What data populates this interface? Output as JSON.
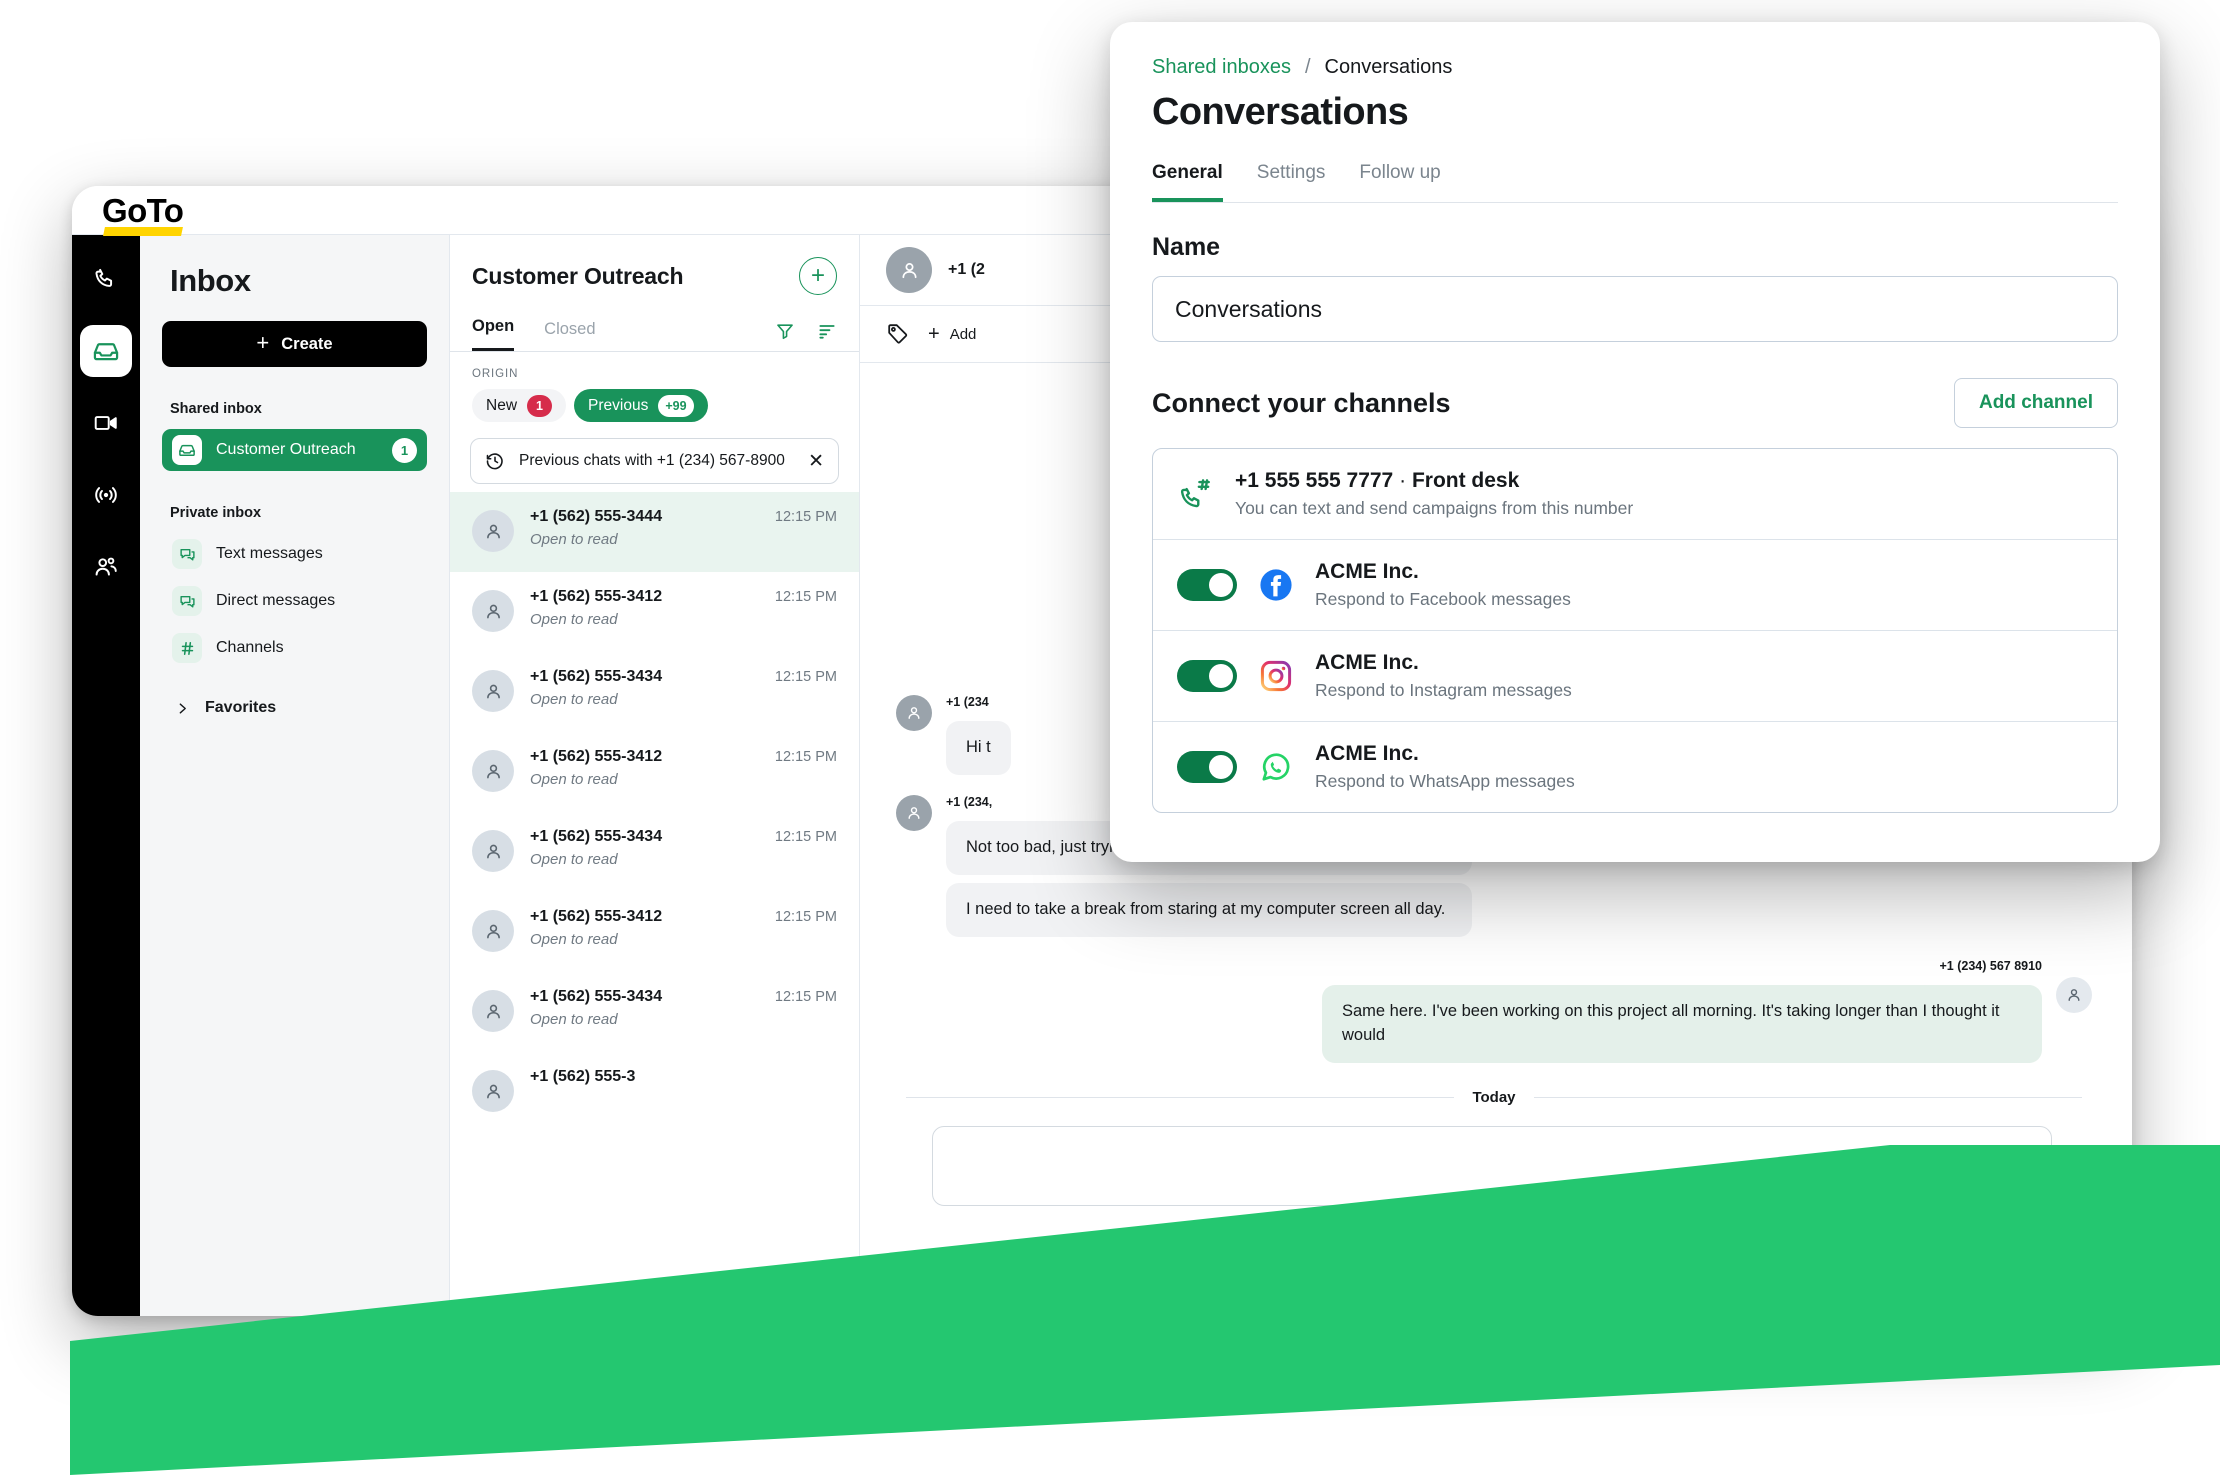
{
  "brand": {
    "name": "GoTo"
  },
  "rail": {
    "items": [
      {
        "name": "phone-icon",
        "label": "Calls"
      },
      {
        "name": "inbox-icon",
        "label": "Inbox",
        "active": true
      },
      {
        "name": "meetings-icon",
        "label": "Meetings"
      },
      {
        "name": "broadcast-icon",
        "label": "Campaigns"
      },
      {
        "name": "contacts-icon",
        "label": "Contacts"
      }
    ]
  },
  "nav": {
    "title": "Inbox",
    "create_label": "Create",
    "shared_section": "Shared inbox",
    "shared_items": [
      {
        "label": "Customer Outreach",
        "badge": "1",
        "selected": true
      }
    ],
    "private_section": "Private inbox",
    "private_items": [
      {
        "label": "Text messages",
        "icon": "chat-icon"
      },
      {
        "label": "Direct messages",
        "icon": "chat-icon"
      },
      {
        "label": "Channels",
        "icon": "hash-icon"
      }
    ],
    "favorites_label": "Favorites"
  },
  "list": {
    "title": "Customer Outreach",
    "tabs": [
      {
        "label": "Open",
        "active": true
      },
      {
        "label": "Closed",
        "active": false
      }
    ],
    "origin_label": "ORIGIN",
    "chips": [
      {
        "label": "New",
        "count": "1",
        "style": "light"
      },
      {
        "label": "Previous",
        "count": "+99",
        "style": "green"
      }
    ],
    "search_filter": "Previous chats with +1 (234) 567-8900",
    "conversations": [
      {
        "number": "+1 (562) 555-3444",
        "time": "12:15 PM",
        "preview": "Open to read",
        "selected": true
      },
      {
        "number": "+1 (562) 555-3412",
        "time": "12:15 PM",
        "preview": "Open to read",
        "selected": false
      },
      {
        "number": "+1 (562) 555-3434",
        "time": "12:15 PM",
        "preview": "Open to read",
        "selected": false
      },
      {
        "number": "+1 (562) 555-3412",
        "time": "12:15 PM",
        "preview": "Open to read",
        "selected": false
      },
      {
        "number": "+1 (562) 555-3434",
        "time": "12:15 PM",
        "preview": "Open to read",
        "selected": false
      },
      {
        "number": "+1 (562) 555-3412",
        "time": "12:15 PM",
        "preview": "Open to read",
        "selected": false
      },
      {
        "number": "+1 (562) 555-3434",
        "time": "12:15 PM",
        "preview": "Open to read",
        "selected": false
      },
      {
        "number": "+1 (562) 555-3",
        "time": "",
        "preview": "",
        "selected": false
      }
    ]
  },
  "chat": {
    "header_number": "+1 (2",
    "add_tag_label": "Add",
    "messages": [
      {
        "dir": "in",
        "meta": "+1 (234",
        "text": "Hi t"
      },
      {
        "dir": "in",
        "meta": "+1 (234,",
        "text": "Not too bad, just trying to catch up on some work. How about you?"
      },
      {
        "dir": "in",
        "meta": "",
        "text": "I need to take a break from staring at my computer screen all day."
      },
      {
        "dir": "out",
        "meta": "+1 (234) 567 8910",
        "text": "Same here. I've been working on this project all morning. It's taking longer than I thought it would"
      }
    ],
    "day_divider": "Today"
  },
  "panel": {
    "breadcrumb_parent": "Shared inboxes",
    "breadcrumb_sep": "/",
    "breadcrumb_current": "Conversations",
    "title": "Conversations",
    "tabs": [
      {
        "label": "General",
        "active": true
      },
      {
        "label": "Settings",
        "active": false
      },
      {
        "label": "Follow up",
        "active": false
      }
    ],
    "name_label": "Name",
    "name_value": "Conversations",
    "channels_title": "Connect your channels",
    "add_channel_label": "Add channel",
    "channels": [
      {
        "icon": "phone-hash-icon",
        "title": "+1 555 555 7777",
        "separator": "·",
        "subtitle": "Front desk",
        "desc": "You can text and send campaigns from this number",
        "has_toggle": false
      },
      {
        "icon": "facebook-icon",
        "title": "ACME Inc.",
        "desc": "Respond to Facebook messages",
        "has_toggle": true,
        "toggle_on": true
      },
      {
        "icon": "instagram-icon",
        "title": "ACME Inc.",
        "desc": "Respond to Instagram messages",
        "has_toggle": true,
        "toggle_on": true
      },
      {
        "icon": "whatsapp-icon",
        "title": "ACME Inc.",
        "desc": "Respond to WhatsApp messages",
        "has_toggle": true,
        "toggle_on": true
      }
    ]
  },
  "colors": {
    "brand_green": "#19935b",
    "toggle_green": "#0a7a48",
    "accent_yellow": "#ffd400",
    "banner_green": "#24c770",
    "black": "#000000",
    "badge_red": "#d62c4b"
  }
}
